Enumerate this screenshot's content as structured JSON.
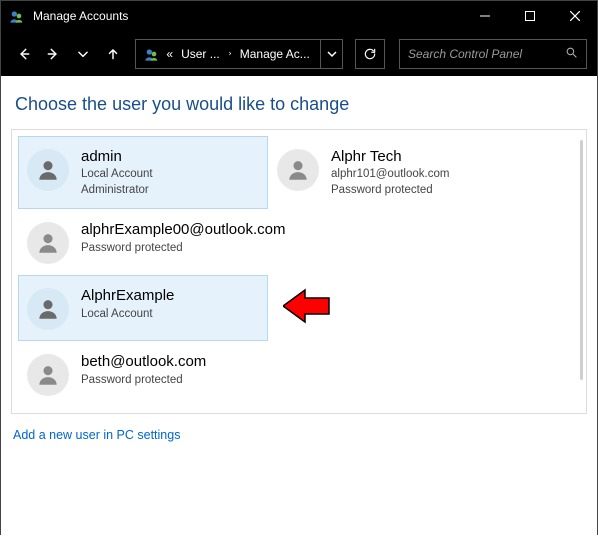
{
  "window": {
    "title": "Manage Accounts"
  },
  "breadcrumb": {
    "back_chevrons": "«",
    "item1": "User ...",
    "item2": "Manage Ac..."
  },
  "search": {
    "placeholder": "Search Control Panel"
  },
  "heading": "Choose the user you would like to change",
  "users": [
    {
      "name": "admin",
      "line1": "Local Account",
      "line2": "Administrator",
      "selected": true
    },
    {
      "name": "Alphr Tech",
      "line1": "alphr101@outlook.com",
      "line2": "Password protected",
      "selected": false
    },
    {
      "name": "alphrExample00@outlook.com",
      "line1": "Password protected",
      "line2": "",
      "selected": false
    },
    {
      "name": "AlphrExample",
      "line1": "Local Account",
      "line2": "",
      "selected": true
    },
    {
      "name": "beth@outlook.com",
      "line1": "Password protected",
      "line2": "",
      "selected": false
    }
  ],
  "footer": {
    "add_link": "Add a new user in PC settings"
  }
}
